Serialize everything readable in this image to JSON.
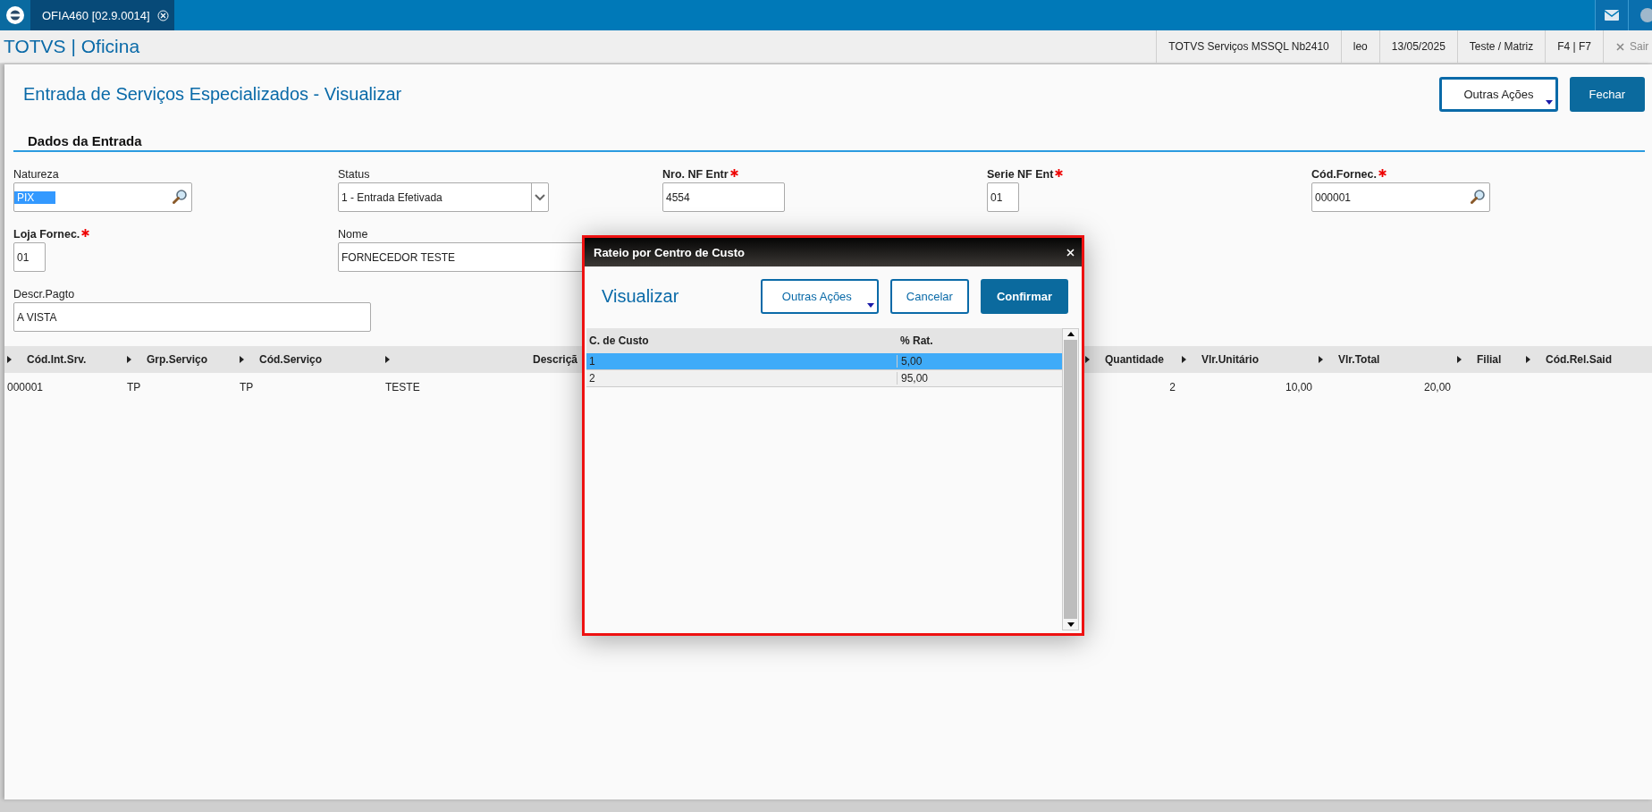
{
  "top_bar": {
    "tabs": [
      {
        "label": "OFIA460 [02.9.0014]",
        "selected": true
      }
    ]
  },
  "header": {
    "app_title": "TOTVS | Oficina",
    "info": [
      "TOTVS Serviços MSSQL Nb2410",
      "leo",
      "13/05/2025",
      "Teste / Matriz",
      "F4 | F7"
    ],
    "exit": "Sair"
  },
  "page": {
    "title": "Entrada de Serviços Especializados - Visualizar",
    "buttons": [
      {
        "label": "Outras Ações",
        "kind": "menu"
      },
      {
        "label": "Fechar",
        "kind": "primary"
      }
    ]
  },
  "section": "Dados da Entrada",
  "field_rows": [
    [
      {
        "label": "Natureza",
        "required": false,
        "kind": "lookup",
        "value": "PIX",
        "highlighted": true
      },
      {
        "label": "Status",
        "required": false,
        "kind": "select",
        "value": "1 - Entrada Efetivada",
        "highlighted": false
      },
      {
        "label": "Nro. NF Entr",
        "required": true,
        "kind": "text",
        "value": "4554",
        "highlighted": false
      },
      {
        "label": "Serie NF Ent",
        "required": true,
        "kind": "short",
        "value": "01",
        "highlighted": false
      },
      {
        "label": "Cód.Fornec.",
        "required": true,
        "kind": "lookup",
        "value": "000001",
        "highlighted": false
      }
    ],
    [
      {
        "label": "Loja Fornec.",
        "required": true,
        "kind": "short",
        "value": "01",
        "highlighted": false
      },
      {
        "label": "Nome",
        "required": false,
        "kind": "wide",
        "value": "FORNECEDOR TESTE",
        "highlighted": false
      }
    ],
    [
      {
        "label": "Descr.Pagto",
        "required": false,
        "kind": "wide",
        "value": "A VISTA",
        "highlighted": false
      }
    ]
  ],
  "grid": {
    "columns": [
      "Cód.Int.Srv.",
      "Grp.Serviço",
      "Cód.Serviço",
      "Descriçã",
      "Quantidade",
      "Vlr.Unitário",
      "Vlr.Total",
      "Filial",
      "Cód.Rel.Said"
    ],
    "rows": [
      [
        "000001",
        "TP",
        "TP",
        "TESTE",
        "2",
        "10,00",
        "20,00",
        "",
        ""
      ]
    ]
  },
  "dialog": {
    "title": "Rateio por Centro de Custo",
    "heading": "Visualizar",
    "buttons": [
      {
        "label": "Outras Ações",
        "kind": "menu"
      },
      {
        "label": "Cancelar",
        "kind": "outline"
      },
      {
        "label": "Confirmar",
        "kind": "primary"
      }
    ],
    "columns": [
      "C. de Custo",
      "% Rat."
    ],
    "rows": [
      {
        "cells": [
          "1",
          "5,00"
        ],
        "selected": true
      },
      {
        "cells": [
          "2",
          "95,00"
        ],
        "selected": false
      }
    ]
  }
}
